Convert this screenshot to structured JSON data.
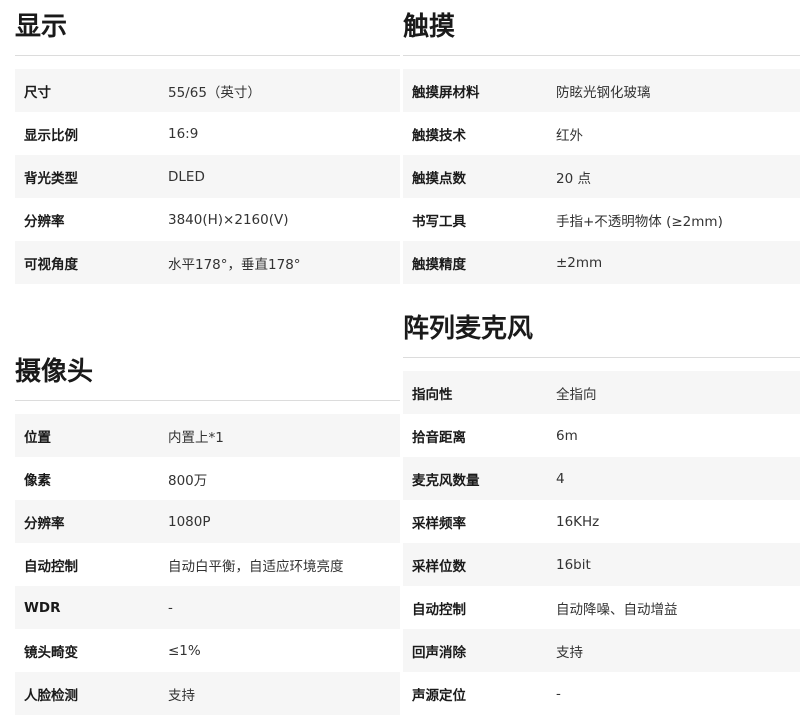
{
  "display": {
    "title": "显示",
    "rows": [
      {
        "label": "尺寸",
        "value": "55/65（英寸）"
      },
      {
        "label": "显示比例",
        "value": "16:9"
      },
      {
        "label": "背光类型",
        "value": "DLED"
      },
      {
        "label": "分辨率",
        "value": "3840(H)×2160(V)"
      },
      {
        "label": "可视角度",
        "value": "水平178°，垂直178°"
      }
    ]
  },
  "touch": {
    "title": "触摸",
    "rows": [
      {
        "label": "触摸屏材料",
        "value": "防眩光钢化玻璃"
      },
      {
        "label": "触摸技术",
        "value": "红外"
      },
      {
        "label": "触摸点数",
        "value": "20 点"
      },
      {
        "label": "书写工具",
        "value": "手指+不透明物体 (≥2mm)"
      },
      {
        "label": "触摸精度",
        "value": "±2mm"
      }
    ]
  },
  "camera": {
    "title": "摄像头",
    "rows": [
      {
        "label": "位置",
        "value": "内置上*1"
      },
      {
        "label": "像素",
        "value": "800万"
      },
      {
        "label": "分辨率",
        "value": "1080P"
      },
      {
        "label": "自动控制",
        "value": "自动白平衡，自适应环境亮度"
      },
      {
        "label": "WDR",
        "value": "-"
      },
      {
        "label": "镜头畸变",
        "value": "≤1%"
      },
      {
        "label": "人脸检测",
        "value": "支持"
      }
    ]
  },
  "mic": {
    "title": "阵列麦克风",
    "rows": [
      {
        "label": "指向性",
        "value": "全指向"
      },
      {
        "label": "拾音距离",
        "value": "6m"
      },
      {
        "label": "麦克风数量",
        "value": "4"
      },
      {
        "label": "采样频率",
        "value": "16KHz"
      },
      {
        "label": "采样位数",
        "value": "16bit"
      },
      {
        "label": "自动控制",
        "value": "自动降噪、自动增益"
      },
      {
        "label": "回声消除",
        "value": "支持"
      },
      {
        "label": "声源定位",
        "value": "-"
      }
    ]
  }
}
